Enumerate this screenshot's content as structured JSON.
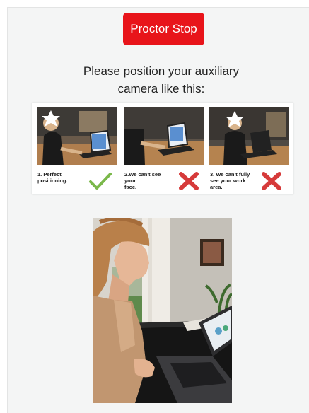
{
  "proctor_button": {
    "label": "Proctor Stop",
    "color": "#e8141a"
  },
  "instruction": {
    "line1": "Please position your auxiliary",
    "line2": "camera like this:"
  },
  "examples": [
    {
      "caption_line1": "1. Perfect",
      "caption_line2": "positioning.",
      "status": "correct",
      "mark_icon": "checkmark-icon",
      "mark_color": "#7ab84a"
    },
    {
      "caption_line1": "2.We can't see your",
      "caption_line2": "face.",
      "status": "incorrect",
      "mark_icon": "cross-icon",
      "mark_color": "#d63a3a"
    },
    {
      "caption_line1": "3. We can't fully",
      "caption_line2": "see your work area.",
      "status": "incorrect",
      "mark_icon": "cross-icon",
      "mark_color": "#d63a3a"
    }
  ],
  "camera_feed": {
    "icon": "camera-preview-image"
  }
}
